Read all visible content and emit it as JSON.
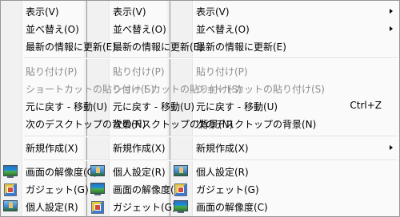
{
  "menus": [
    {
      "items": [
        {
          "label": "表示(V)"
        },
        {
          "label": "並べ替え(O)"
        },
        {
          "label": "最新の情報に更新(E)"
        },
        {
          "label": "貼り付け(P)"
        },
        {
          "label": "ショートカットの貼り付け(S)"
        },
        {
          "label": "元に戻す - 移動(U)"
        },
        {
          "label": "次のデスクトップの背景(N)"
        },
        {
          "label": "新規作成(X)"
        },
        {
          "label": "画面の解像度(C)",
          "icon": "display-icon"
        },
        {
          "label": "ガジェット(G)",
          "icon": "gadget-icon"
        },
        {
          "label": "個人設定(R)",
          "icon": "personalize-icon"
        }
      ]
    },
    {
      "items": [
        {
          "label": "表示(V)"
        },
        {
          "label": "並べ替え(O)"
        },
        {
          "label": "最新の情報に更新(E)"
        },
        {
          "label": "貼り付け(P)"
        },
        {
          "label": "ショートカットの貼り付け(S)"
        },
        {
          "label": "元に戻す - 移動(U)"
        },
        {
          "label": "次のデスクトップの背景(N)"
        },
        {
          "label": "新規作成(X)"
        },
        {
          "label": "個人設定(R)",
          "icon": "personalize-icon"
        },
        {
          "label": "画面の解像度(C)",
          "icon": "display-icon"
        },
        {
          "label": "ガジェット(G)",
          "icon": "gadget-icon"
        }
      ]
    },
    {
      "items": [
        {
          "label": "表示(V)",
          "submenu": true
        },
        {
          "label": "並べ替え(O)",
          "submenu": true
        },
        {
          "label": "最新の情報に更新(E)"
        },
        {
          "label": "貼り付け(P)",
          "disabled": true
        },
        {
          "label": "ショートカットの貼り付け(S)",
          "disabled": true
        },
        {
          "label": "元に戻す - 移動(U)",
          "shortcut": "Ctrl+Z"
        },
        {
          "label": "次のデスクトップの背景(N)"
        },
        {
          "label": "新規作成(X)",
          "submenu": true
        },
        {
          "label": "個人設定(R)",
          "icon": "personalize-icon"
        },
        {
          "label": "ガジェット(G)",
          "icon": "gadget-icon"
        },
        {
          "label": "画面の解像度(C)",
          "icon": "display-icon"
        }
      ]
    }
  ],
  "colors": {
    "disabled_text": "#8d8d8d",
    "menu_border": "#979797"
  }
}
